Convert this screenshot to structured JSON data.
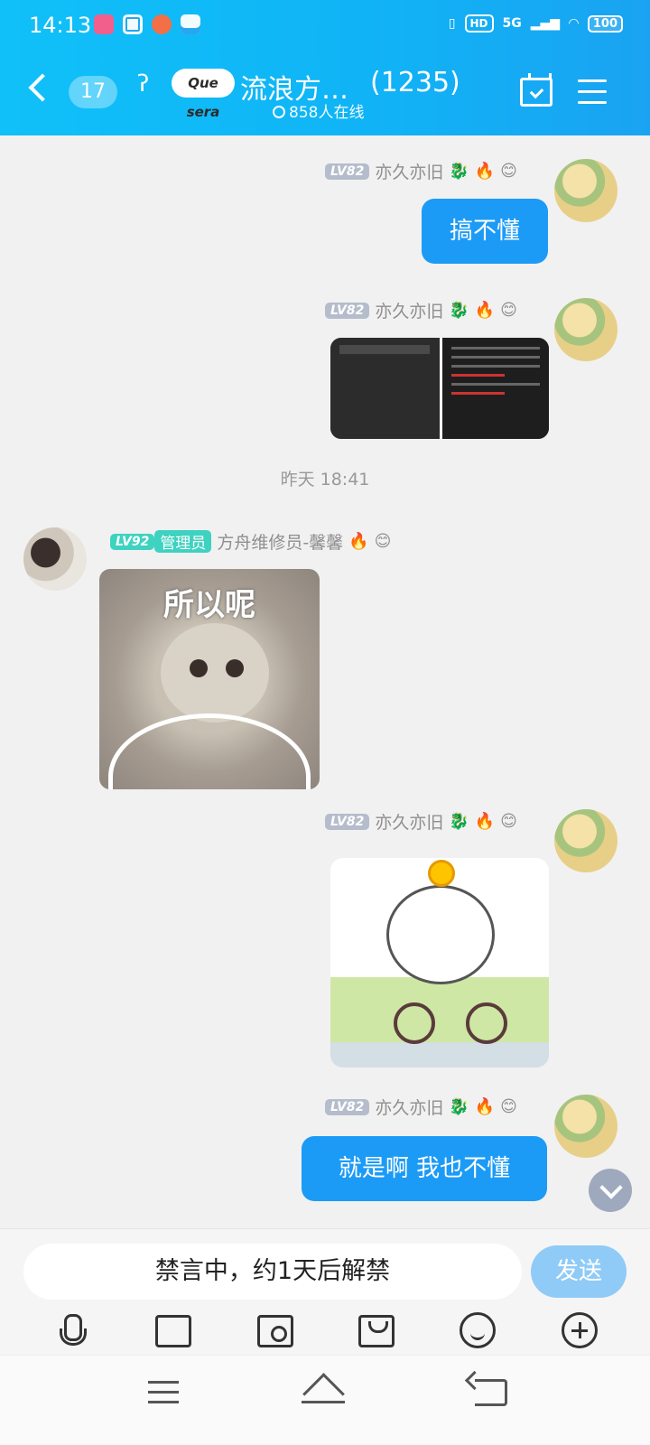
{
  "status_bar": {
    "time": "14:13",
    "hd": "HD",
    "network": "5G",
    "battery": "100"
  },
  "header": {
    "unread_count": "17",
    "group_logo_text": "Que sera",
    "group_name": "流浪方…",
    "member_count": "(1235)",
    "online_text": "858人在线"
  },
  "messages": [
    {
      "level": "LV82",
      "sender": "亦久亦旧",
      "text": "搞不懂"
    },
    {
      "level": "LV82",
      "sender": "亦久亦旧",
      "type": "image"
    },
    {
      "timestamp": "昨天 18:41"
    },
    {
      "level": "LV92",
      "role": "管理员",
      "sender": "方舟维修员-馨馨",
      "sticker_caption": "所以呢"
    },
    {
      "level": "LV82",
      "sender": "亦久亦旧",
      "type": "sticker"
    },
    {
      "level": "LV82",
      "sender": "亦久亦旧",
      "text": "就是啊 我也不懂"
    }
  ],
  "input": {
    "muted_text": "禁言中，约1天后解禁",
    "send_label": "发送"
  },
  "colors": {
    "header_blue": "#10b4f6",
    "bubble_blue": "#1c9bf6",
    "send_disabled": "#8fcbf6"
  }
}
